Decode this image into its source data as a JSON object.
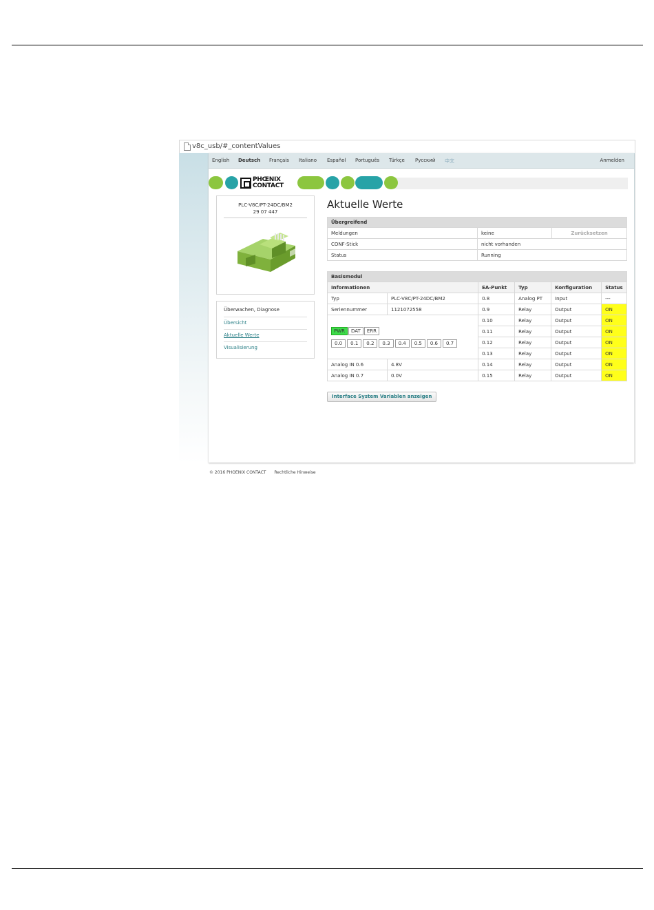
{
  "browser": {
    "url": "v8c_usb/#_contentValues"
  },
  "languages": [
    {
      "label": "English"
    },
    {
      "label": "Deutsch"
    },
    {
      "label": "Français"
    },
    {
      "label": "Italiano"
    },
    {
      "label": "Español"
    },
    {
      "label": "Português"
    },
    {
      "label": "Türkçe"
    },
    {
      "label": "Русский"
    },
    {
      "label": "中文"
    }
  ],
  "login_label": "Anmelden",
  "logo": {
    "line1": "PHŒNIX",
    "line2": "CONTACT"
  },
  "product": {
    "name": "PLC-V8C/PT-24DC/BM2",
    "number": "29 07 447"
  },
  "nav": {
    "heading": "Überwachen, Diagnose",
    "items": [
      "Übersicht",
      "Aktuelle Werte",
      "Visualisierung"
    ]
  },
  "page_title": "Aktuelle Werte",
  "overview": {
    "header": "Übergreifend",
    "rows": [
      {
        "label": "Meldungen",
        "value": "keine",
        "action": "Zurücksetzen"
      },
      {
        "label": "CONF-Stick",
        "value": "nicht vorhanden"
      },
      {
        "label": "Status",
        "value": "Running"
      }
    ]
  },
  "basis": {
    "header": "Basismodul",
    "columns": [
      "Informationen",
      "EA-Punkt",
      "Typ",
      "Konfiguration",
      "Status"
    ],
    "info": [
      {
        "label": "Typ",
        "value": "PLC-V8C/PT-24DC/BM2"
      },
      {
        "label": "Seriennummer",
        "value": "1121072558"
      },
      {
        "label": "Analog IN 0.6",
        "value": "4.8V"
      },
      {
        "label": "Analog IN 0.7",
        "value": "0.0V"
      }
    ],
    "leds": [
      "PWR",
      "DAT",
      "ERR"
    ],
    "bits": [
      "0.0",
      "0.1",
      "0.2",
      "0.3",
      "0.4",
      "0.5",
      "0.6",
      "0.7"
    ],
    "points": [
      {
        "point": "0.8",
        "type": "Analog PT",
        "config": "Input",
        "status": "---"
      },
      {
        "point": "0.9",
        "type": "Relay",
        "config": "Output",
        "status": "ON"
      },
      {
        "point": "0.10",
        "type": "Relay",
        "config": "Output",
        "status": "ON"
      },
      {
        "point": "0.11",
        "type": "Relay",
        "config": "Output",
        "status": "ON"
      },
      {
        "point": "0.12",
        "type": "Relay",
        "config": "Output",
        "status": "ON"
      },
      {
        "point": "0.13",
        "type": "Relay",
        "config": "Output",
        "status": "ON"
      },
      {
        "point": "0.14",
        "type": "Relay",
        "config": "Output",
        "status": "ON"
      },
      {
        "point": "0.15",
        "type": "Relay",
        "config": "Output",
        "status": "ON"
      }
    ]
  },
  "interface_button": "Interface System Variablen anzeigen",
  "footer": {
    "copyright": "© 2016 PHOENIX CONTACT",
    "legal": "Rechtliche Hinweise"
  },
  "colors": {
    "brand_green": "#8cc63f",
    "brand_teal": "#27a3a7",
    "status_on": "#ffff1a",
    "led_pwr": "#3ddc4a",
    "link": "#2a7f86"
  }
}
